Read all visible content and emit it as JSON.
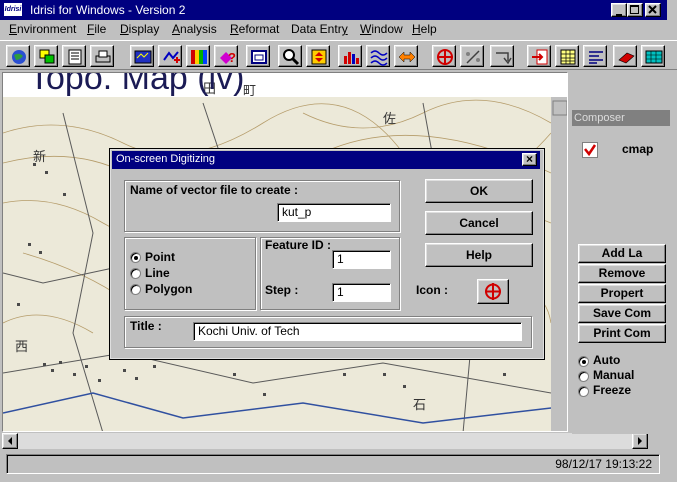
{
  "app": {
    "logo_text": "Idrisi",
    "title": "Idrisi for Windows  -  Version 2"
  },
  "menu": [
    {
      "label": "Environment",
      "mnemonic": "E"
    },
    {
      "label": "File",
      "mnemonic": "F"
    },
    {
      "label": "Display",
      "mnemonic": "D"
    },
    {
      "label": "Analysis",
      "mnemonic": "A"
    },
    {
      "label": "Reformat",
      "mnemonic": "R"
    },
    {
      "label": "Data Entry",
      "mnemonic": "y"
    },
    {
      "label": "Window",
      "mnemonic": "W"
    },
    {
      "label": "Help",
      "mnemonic": "H"
    }
  ],
  "toolbar": {
    "icons": [
      "globe-icon",
      "layers-icon",
      "document-icon",
      "print-icon",
      "map-display-icon",
      "add-layer-icon",
      "palette-icon",
      "query-icon",
      "window-icon",
      "zoom-icon",
      "pan-icon",
      "histogram-icon",
      "wave-icon",
      "arrows-icon",
      "digitize-icon",
      "measure-icon",
      "undo-icon",
      "import-icon",
      "table-icon",
      "list-icon",
      "eraser-icon",
      "grid-icon"
    ]
  },
  "map": {
    "heading": "Topo. Map (iv)"
  },
  "composer": {
    "title": "Composer",
    "layer_name": "cmap",
    "buttons": [
      "Add La",
      "Remove",
      "Propert",
      "Save Com",
      "Print Com"
    ],
    "modes": [
      {
        "label": "Auto",
        "selected": true
      },
      {
        "label": "Manual",
        "selected": false
      },
      {
        "label": "Freeze",
        "selected": false
      }
    ]
  },
  "dialog": {
    "title": "On-screen Digitizing",
    "name_label": "Name of vector file to create :",
    "file_name": "kut_p",
    "feature_types": [
      {
        "label": "Point",
        "selected": true
      },
      {
        "label": "Line",
        "selected": false
      },
      {
        "label": "Polygon",
        "selected": false
      }
    ],
    "feature_id_label": "Feature ID :",
    "feature_id": "1",
    "step_label": "Step :",
    "step": "1",
    "icon_label": "Icon :",
    "title_label": "Title :",
    "title_value": "Kochi Univ. of Tech",
    "ok_label": "OK",
    "cancel_label": "Cancel",
    "help_label": "Help",
    "close_symbol": "×"
  },
  "status": {
    "datetime": "98/12/17 19:13:22"
  },
  "colors": {
    "titlebar": "#000080",
    "face": "#c0c0c0",
    "map_background": "#efeee5",
    "digitize_red": "#d00000"
  }
}
